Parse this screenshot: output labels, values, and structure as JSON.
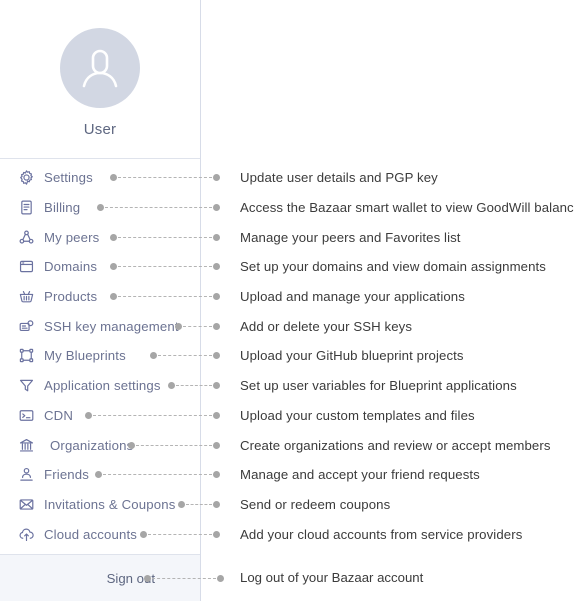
{
  "profile": {
    "name": "User",
    "avatar_icon": "user-avatar-icon",
    "avatar_bg": "#d2d7e3"
  },
  "colors": {
    "icon": "#6b72a0",
    "menu_label": "#6c7392",
    "description": "#3b3b3b",
    "divider": "#dfe3ec",
    "connector_dot": "#a6a6a6",
    "footer_bg": "#f4f6fa"
  },
  "menu": {
    "items": [
      {
        "icon": "gear-icon",
        "label": "Settings",
        "description": "Update user details and PGP key"
      },
      {
        "icon": "document-icon",
        "label": "Billing",
        "description": "Access the Bazaar smart wallet to view GoodWill balance"
      },
      {
        "icon": "peers-icon",
        "label": "My peers",
        "description": "Manage your peers and Favorites list"
      },
      {
        "icon": "window-icon",
        "label": "Domains",
        "description": "Set up your domains and view domain assignments"
      },
      {
        "icon": "basket-icon",
        "label": "Products",
        "description": "Upload and manage your applications"
      },
      {
        "icon": "ssh-key-icon",
        "label": "SSH key management",
        "description": "Add or delete your SSH keys"
      },
      {
        "icon": "blueprint-icon",
        "label": "My Blueprints",
        "description": "Upload your GitHub blueprint projects"
      },
      {
        "icon": "funnel-icon",
        "label": "Application settings",
        "description": "Set up user variables for Blueprint applications"
      },
      {
        "icon": "terminal-icon",
        "label": "CDN",
        "description": "Upload your custom templates and files"
      },
      {
        "icon": "bank-icon",
        "label": "Organizations",
        "description": "Create organizations and review or accept members"
      },
      {
        "icon": "friends-icon",
        "label": "Friends",
        "description": "Manage and accept your friend requests"
      },
      {
        "icon": "envelope-icon",
        "label": "Invitations & Coupons",
        "description": "Send or redeem coupons"
      },
      {
        "icon": "cloud-upload-icon",
        "label": "Cloud accounts",
        "description": "Add your cloud accounts from service providers"
      }
    ]
  },
  "footer": {
    "label": "Sign out",
    "description": "Log out of your Bazaar account"
  }
}
